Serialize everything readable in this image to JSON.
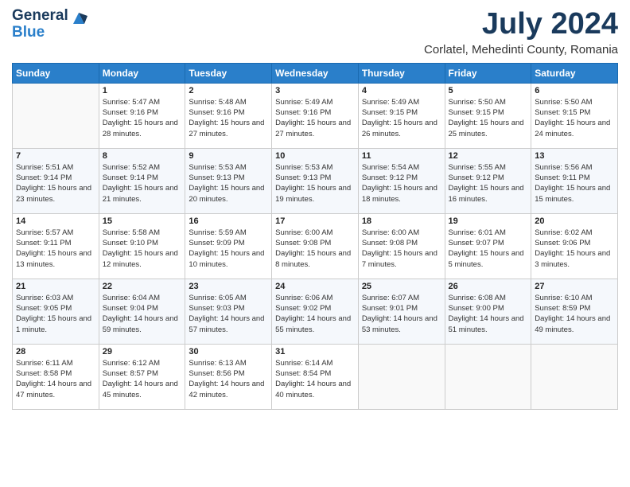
{
  "logo": {
    "general": "General",
    "blue": "Blue",
    "icon_title": "GeneralBlue logo"
  },
  "title": "July 2024",
  "location": "Corlatel, Mehedinti County, Romania",
  "days_of_week": [
    "Sunday",
    "Monday",
    "Tuesday",
    "Wednesday",
    "Thursday",
    "Friday",
    "Saturday"
  ],
  "weeks": [
    [
      {
        "day": "",
        "sunrise": "",
        "sunset": "",
        "daylight": ""
      },
      {
        "day": "1",
        "sunrise": "Sunrise: 5:47 AM",
        "sunset": "Sunset: 9:16 PM",
        "daylight": "Daylight: 15 hours and 28 minutes."
      },
      {
        "day": "2",
        "sunrise": "Sunrise: 5:48 AM",
        "sunset": "Sunset: 9:16 PM",
        "daylight": "Daylight: 15 hours and 27 minutes."
      },
      {
        "day": "3",
        "sunrise": "Sunrise: 5:49 AM",
        "sunset": "Sunset: 9:16 PM",
        "daylight": "Daylight: 15 hours and 27 minutes."
      },
      {
        "day": "4",
        "sunrise": "Sunrise: 5:49 AM",
        "sunset": "Sunset: 9:15 PM",
        "daylight": "Daylight: 15 hours and 26 minutes."
      },
      {
        "day": "5",
        "sunrise": "Sunrise: 5:50 AM",
        "sunset": "Sunset: 9:15 PM",
        "daylight": "Daylight: 15 hours and 25 minutes."
      },
      {
        "day": "6",
        "sunrise": "Sunrise: 5:50 AM",
        "sunset": "Sunset: 9:15 PM",
        "daylight": "Daylight: 15 hours and 24 minutes."
      }
    ],
    [
      {
        "day": "7",
        "sunrise": "Sunrise: 5:51 AM",
        "sunset": "Sunset: 9:14 PM",
        "daylight": "Daylight: 15 hours and 23 minutes."
      },
      {
        "day": "8",
        "sunrise": "Sunrise: 5:52 AM",
        "sunset": "Sunset: 9:14 PM",
        "daylight": "Daylight: 15 hours and 21 minutes."
      },
      {
        "day": "9",
        "sunrise": "Sunrise: 5:53 AM",
        "sunset": "Sunset: 9:13 PM",
        "daylight": "Daylight: 15 hours and 20 minutes."
      },
      {
        "day": "10",
        "sunrise": "Sunrise: 5:53 AM",
        "sunset": "Sunset: 9:13 PM",
        "daylight": "Daylight: 15 hours and 19 minutes."
      },
      {
        "day": "11",
        "sunrise": "Sunrise: 5:54 AM",
        "sunset": "Sunset: 9:12 PM",
        "daylight": "Daylight: 15 hours and 18 minutes."
      },
      {
        "day": "12",
        "sunrise": "Sunrise: 5:55 AM",
        "sunset": "Sunset: 9:12 PM",
        "daylight": "Daylight: 15 hours and 16 minutes."
      },
      {
        "day": "13",
        "sunrise": "Sunrise: 5:56 AM",
        "sunset": "Sunset: 9:11 PM",
        "daylight": "Daylight: 15 hours and 15 minutes."
      }
    ],
    [
      {
        "day": "14",
        "sunrise": "Sunrise: 5:57 AM",
        "sunset": "Sunset: 9:11 PM",
        "daylight": "Daylight: 15 hours and 13 minutes."
      },
      {
        "day": "15",
        "sunrise": "Sunrise: 5:58 AM",
        "sunset": "Sunset: 9:10 PM",
        "daylight": "Daylight: 15 hours and 12 minutes."
      },
      {
        "day": "16",
        "sunrise": "Sunrise: 5:59 AM",
        "sunset": "Sunset: 9:09 PM",
        "daylight": "Daylight: 15 hours and 10 minutes."
      },
      {
        "day": "17",
        "sunrise": "Sunrise: 6:00 AM",
        "sunset": "Sunset: 9:08 PM",
        "daylight": "Daylight: 15 hours and 8 minutes."
      },
      {
        "day": "18",
        "sunrise": "Sunrise: 6:00 AM",
        "sunset": "Sunset: 9:08 PM",
        "daylight": "Daylight: 15 hours and 7 minutes."
      },
      {
        "day": "19",
        "sunrise": "Sunrise: 6:01 AM",
        "sunset": "Sunset: 9:07 PM",
        "daylight": "Daylight: 15 hours and 5 minutes."
      },
      {
        "day": "20",
        "sunrise": "Sunrise: 6:02 AM",
        "sunset": "Sunset: 9:06 PM",
        "daylight": "Daylight: 15 hours and 3 minutes."
      }
    ],
    [
      {
        "day": "21",
        "sunrise": "Sunrise: 6:03 AM",
        "sunset": "Sunset: 9:05 PM",
        "daylight": "Daylight: 15 hours and 1 minute."
      },
      {
        "day": "22",
        "sunrise": "Sunrise: 6:04 AM",
        "sunset": "Sunset: 9:04 PM",
        "daylight": "Daylight: 14 hours and 59 minutes."
      },
      {
        "day": "23",
        "sunrise": "Sunrise: 6:05 AM",
        "sunset": "Sunset: 9:03 PM",
        "daylight": "Daylight: 14 hours and 57 minutes."
      },
      {
        "day": "24",
        "sunrise": "Sunrise: 6:06 AM",
        "sunset": "Sunset: 9:02 PM",
        "daylight": "Daylight: 14 hours and 55 minutes."
      },
      {
        "day": "25",
        "sunrise": "Sunrise: 6:07 AM",
        "sunset": "Sunset: 9:01 PM",
        "daylight": "Daylight: 14 hours and 53 minutes."
      },
      {
        "day": "26",
        "sunrise": "Sunrise: 6:08 AM",
        "sunset": "Sunset: 9:00 PM",
        "daylight": "Daylight: 14 hours and 51 minutes."
      },
      {
        "day": "27",
        "sunrise": "Sunrise: 6:10 AM",
        "sunset": "Sunset: 8:59 PM",
        "daylight": "Daylight: 14 hours and 49 minutes."
      }
    ],
    [
      {
        "day": "28",
        "sunrise": "Sunrise: 6:11 AM",
        "sunset": "Sunset: 8:58 PM",
        "daylight": "Daylight: 14 hours and 47 minutes."
      },
      {
        "day": "29",
        "sunrise": "Sunrise: 6:12 AM",
        "sunset": "Sunset: 8:57 PM",
        "daylight": "Daylight: 14 hours and 45 minutes."
      },
      {
        "day": "30",
        "sunrise": "Sunrise: 6:13 AM",
        "sunset": "Sunset: 8:56 PM",
        "daylight": "Daylight: 14 hours and 42 minutes."
      },
      {
        "day": "31",
        "sunrise": "Sunrise: 6:14 AM",
        "sunset": "Sunset: 8:54 PM",
        "daylight": "Daylight: 14 hours and 40 minutes."
      },
      {
        "day": "",
        "sunrise": "",
        "sunset": "",
        "daylight": ""
      },
      {
        "day": "",
        "sunrise": "",
        "sunset": "",
        "daylight": ""
      },
      {
        "day": "",
        "sunrise": "",
        "sunset": "",
        "daylight": ""
      }
    ]
  ]
}
